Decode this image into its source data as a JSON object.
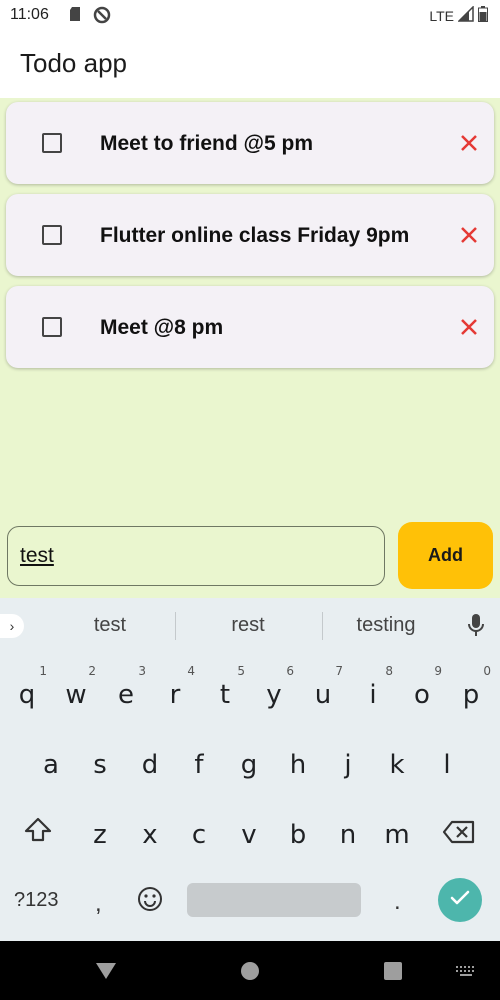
{
  "status_bar": {
    "time": "11:06",
    "network": "LTE"
  },
  "app": {
    "title": "Todo app"
  },
  "todos": [
    {
      "text": "Meet to friend @5 pm",
      "checked": false
    },
    {
      "text": "Flutter online class Friday 9pm",
      "checked": false
    },
    {
      "text": "Meet @8 pm",
      "checked": false
    }
  ],
  "input": {
    "value": "test"
  },
  "add_button": {
    "label": "Add"
  },
  "keyboard": {
    "suggestions": [
      "test",
      "rest",
      "testing"
    ],
    "row1": [
      {
        "key": "q",
        "hint": "1"
      },
      {
        "key": "w",
        "hint": "2"
      },
      {
        "key": "e",
        "hint": "3"
      },
      {
        "key": "r",
        "hint": "4"
      },
      {
        "key": "t",
        "hint": "5"
      },
      {
        "key": "y",
        "hint": "6"
      },
      {
        "key": "u",
        "hint": "7"
      },
      {
        "key": "i",
        "hint": "8"
      },
      {
        "key": "o",
        "hint": "9"
      },
      {
        "key": "p",
        "hint": "0"
      }
    ],
    "row2": [
      "a",
      "s",
      "d",
      "f",
      "g",
      "h",
      "j",
      "k",
      "l"
    ],
    "row3": [
      "z",
      "x",
      "c",
      "v",
      "b",
      "n",
      "m"
    ],
    "symbols_label": "?123",
    "comma": ",",
    "period": "."
  },
  "colors": {
    "content_bg": "#eaf6cf",
    "card_bg": "#f4f1f6",
    "delete_icon": "#e53935",
    "add_button": "#ffc107",
    "enter_key": "#4db6ac",
    "keyboard_bg": "#e8eef1"
  }
}
